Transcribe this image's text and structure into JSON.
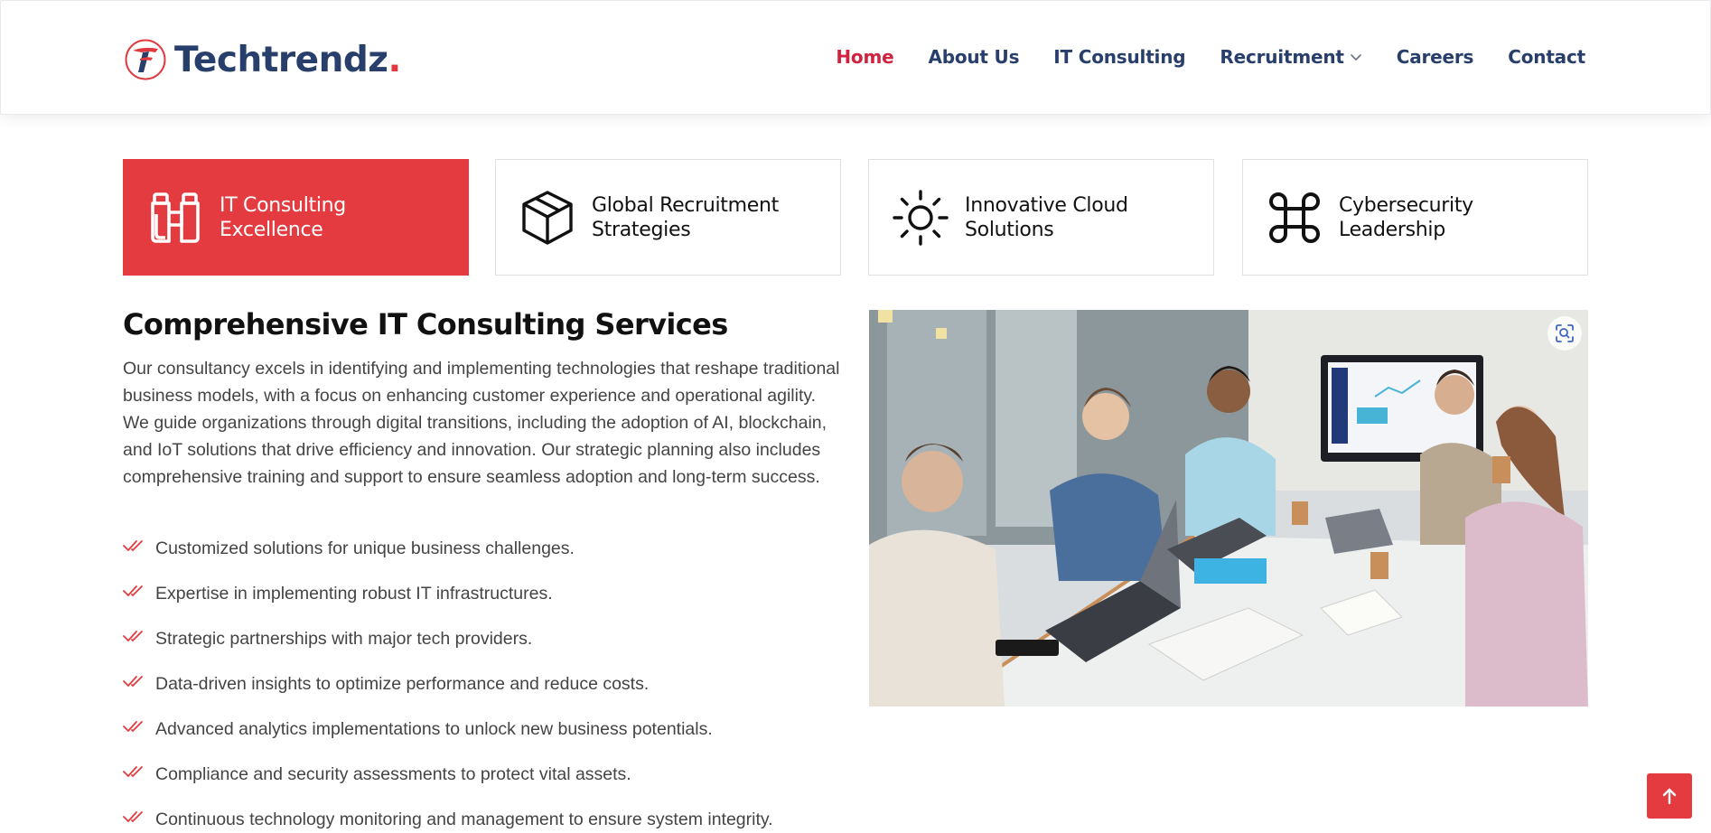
{
  "brand": {
    "name": "Techtrendz",
    "dot": ".",
    "accent": "#e33b3f",
    "navy": "#283e6b"
  },
  "nav": {
    "items": [
      {
        "label": "Home",
        "active": true
      },
      {
        "label": "About Us"
      },
      {
        "label": "IT Consulting"
      },
      {
        "label": "Recruitment",
        "has_dropdown": true
      },
      {
        "label": "Careers"
      },
      {
        "label": "Contact"
      }
    ]
  },
  "tabs": [
    {
      "line1": "IT Consulting",
      "line2": "Excellence",
      "icon": "binoculars-icon",
      "active": true
    },
    {
      "line1": "Global Recruitment",
      "line2": "Strategies",
      "icon": "box-icon"
    },
    {
      "line1": "Innovative Cloud",
      "line2": "Solutions",
      "icon": "sun-icon"
    },
    {
      "line1": "Cybersecurity",
      "line2": "Leadership",
      "icon": "command-icon"
    }
  ],
  "content": {
    "title": "Comprehensive IT Consulting Services",
    "description": "Our consultancy excels in identifying and implementing technologies that reshape traditional business models, with a focus on enhancing customer experience and operational agility. We guide organizations through digital transitions, including the adoption of AI, blockchain, and IoT solutions that drive efficiency and innovation. Our strategic planning also includes comprehensive training and support to ensure seamless adoption and long-term success.",
    "checklist": [
      "Customized solutions for unique business challenges.",
      "Expertise in implementing robust IT infrastructures.",
      "Strategic partnerships with major tech providers.",
      "Data-driven insights to optimize performance and reduce costs.",
      "Advanced analytics implementations to unlock new business potentials.",
      "Compliance and security assessments to protect vital assets.",
      "Continuous technology monitoring and management to ensure system integrity."
    ]
  },
  "icons": {
    "check": "double-check-icon",
    "zoom": "zoom-focus-icon",
    "back_to_top": "arrow-up-icon",
    "dropdown": "chevron-down-icon"
  }
}
